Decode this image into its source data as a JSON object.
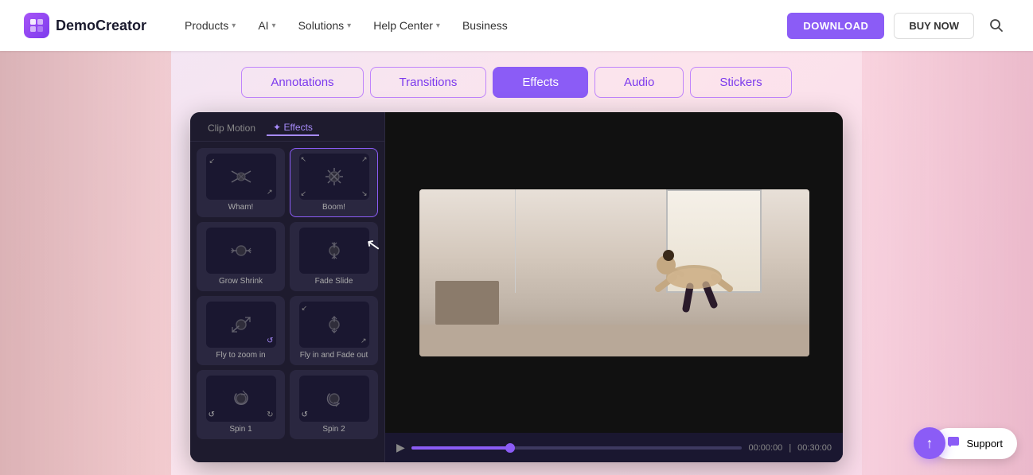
{
  "brand": {
    "logo_text": "DemoCreator",
    "logo_abbr": "D"
  },
  "nav": {
    "items": [
      {
        "label": "Products",
        "has_dropdown": true
      },
      {
        "label": "AI",
        "has_dropdown": true
      },
      {
        "label": "Solutions",
        "has_dropdown": true
      },
      {
        "label": "Help Center",
        "has_dropdown": true
      },
      {
        "label": "Business",
        "has_dropdown": false
      }
    ],
    "download_label": "DOWNLOAD",
    "buy_label": "BUY NOW"
  },
  "tabs": [
    {
      "label": "Annotations",
      "active": false
    },
    {
      "label": "Transitions",
      "active": false
    },
    {
      "label": "Effects",
      "active": true
    },
    {
      "label": "Audio",
      "active": false
    },
    {
      "label": "Stickers",
      "active": false
    }
  ],
  "effects_panel": {
    "header_tabs": [
      {
        "label": "Clip Motion",
        "active": false
      },
      {
        "label": "Effects",
        "active": true
      }
    ],
    "effects": [
      {
        "name": "Wham!",
        "selected": false,
        "arrows": "↙↗↙↗"
      },
      {
        "name": "Boom!",
        "selected": true,
        "arrows": "↖↗↙↘"
      },
      {
        "name": "Grow Shrink",
        "selected": false,
        "arrows": "↔↕"
      },
      {
        "name": "Fade Slide",
        "selected": false,
        "arrows": "↓↑"
      },
      {
        "name": "Fly to zoom in",
        "selected": false,
        "arrows": "↙↗"
      },
      {
        "name": "Fly in and Fade out",
        "selected": false,
        "arrows": "↑↓"
      },
      {
        "name": "Spin 1",
        "selected": false,
        "arrows": "↺↻"
      },
      {
        "name": "Spin 2",
        "selected": false,
        "arrows": "↺↻"
      }
    ]
  },
  "video": {
    "current_time": "00:00:00",
    "total_time": "00:30:00",
    "progress_percent": 30
  },
  "support": {
    "label": "Support"
  }
}
